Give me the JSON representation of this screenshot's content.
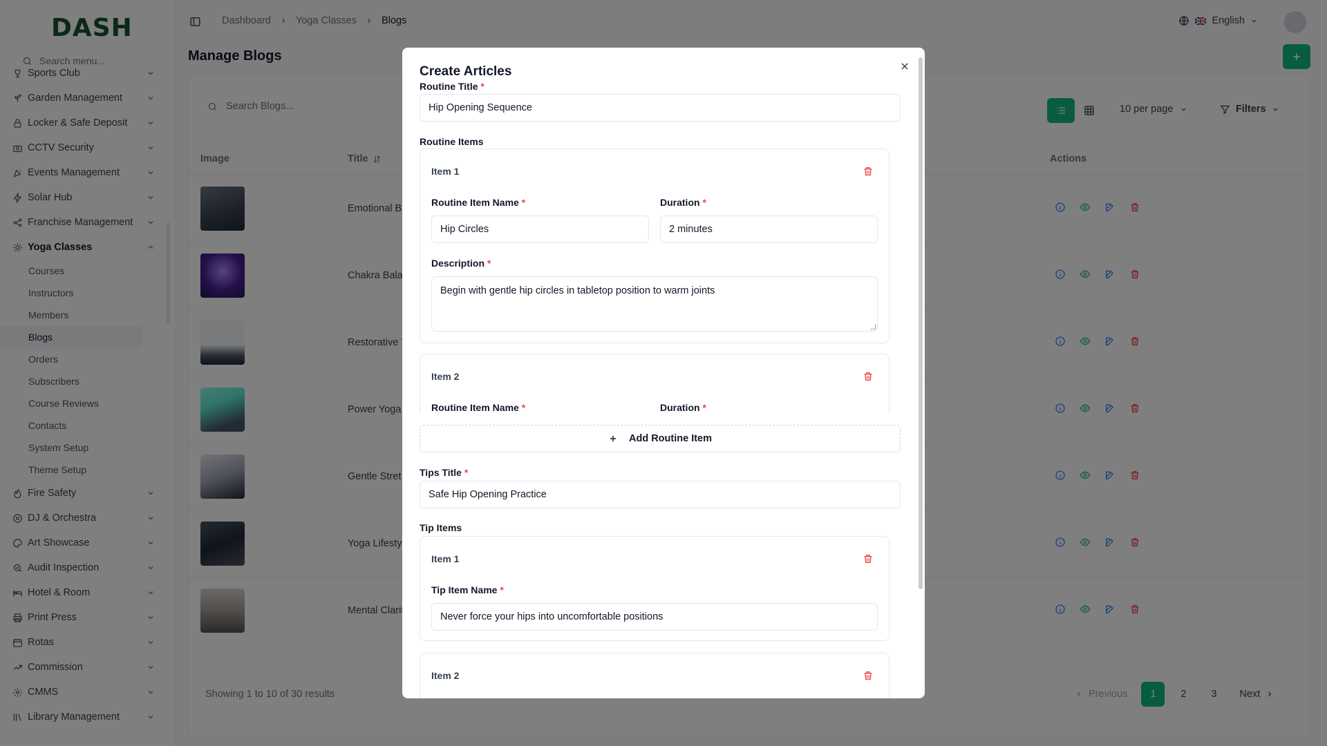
{
  "brand": {
    "logo_text": "DASH",
    "accent": "#10b981"
  },
  "sidebar": {
    "search_placeholder": "Search menu...",
    "items": [
      {
        "label": "Sports Club",
        "icon": "trophy-icon"
      },
      {
        "label": "Garden Management",
        "icon": "plant-icon"
      },
      {
        "label": "Locker & Safe Deposit",
        "icon": "lock-icon"
      },
      {
        "label": "CCTV Security",
        "icon": "camera-icon"
      },
      {
        "label": "Events Management",
        "icon": "party-icon"
      },
      {
        "label": "Solar Hub",
        "icon": "bolt-icon"
      },
      {
        "label": "Franchise Management",
        "icon": "share-icon"
      },
      {
        "label": "Yoga Classes",
        "icon": "sun-icon"
      }
    ],
    "yoga_sub": [
      "Courses",
      "Instructors",
      "Members",
      "Blogs",
      "Orders",
      "Subscribers",
      "Course Reviews",
      "Contacts",
      "System Setup",
      "Theme Setup"
    ],
    "items_after": [
      {
        "label": "Fire Safety",
        "icon": "flame-icon"
      },
      {
        "label": "DJ & Orchestra",
        "icon": "music-icon"
      },
      {
        "label": "Art Showcase",
        "icon": "palette-icon"
      },
      {
        "label": "Audit Inspection",
        "icon": "search-check-icon"
      },
      {
        "label": "Hotel & Room",
        "icon": "bed-icon"
      },
      {
        "label": "Print Press",
        "icon": "printer-icon"
      },
      {
        "label": "Rotas",
        "icon": "calendar-icon"
      },
      {
        "label": "Commission",
        "icon": "trend-icon"
      },
      {
        "label": "CMMS",
        "icon": "gear-icon"
      },
      {
        "label": "Library Management",
        "icon": "library-icon"
      }
    ]
  },
  "topbar": {
    "breadcrumb": [
      "Dashboard",
      "Yoga Classes",
      "Blogs"
    ],
    "language": "English"
  },
  "main": {
    "title": "Manage Blogs",
    "search_placeholder": "Search Blogs...",
    "per_page": "10 per page",
    "filters_label": "Filters",
    "columns": {
      "image": "Image",
      "title": "Title",
      "actions": "Actions"
    },
    "rows": [
      {
        "title": "Emotional Ba"
      },
      {
        "title": "Chakra Balan"
      },
      {
        "title": "Restorative Y"
      },
      {
        "title": "Power Yoga"
      },
      {
        "title": "Gentle Stret"
      },
      {
        "title": "Yoga Lifestyl"
      },
      {
        "title": "Mental Clarit"
      }
    ],
    "showing": "Showing 1 to 10 of 30 results",
    "pager": {
      "prev": "Previous",
      "pages": [
        "1",
        "2",
        "3"
      ],
      "next": "Next"
    }
  },
  "modal": {
    "title": "Create Articles",
    "routine_title_label": "Routine Title",
    "routine_title_value": "Hip Opening Sequence",
    "routine_items_label": "Routine Items",
    "routine_items": [
      {
        "label": "Item 1",
        "name_label": "Routine Item Name",
        "name_value": "Hip Circles",
        "duration_label": "Duration",
        "duration_value": "2 minutes",
        "description_label": "Description",
        "description_value": "Begin with gentle hip circles in tabletop position to warm joints"
      },
      {
        "label": "Item 2",
        "name_label": "Routine Item Name",
        "duration_label": "Duration"
      }
    ],
    "add_routine_item": "Add Routine Item",
    "tips_title_label": "Tips Title",
    "tips_title_value": "Safe Hip Opening Practice",
    "tip_items_label": "Tip Items",
    "tip_items": [
      {
        "label": "Item 1",
        "name_label": "Tip Item Name",
        "name_value": "Never force your hips into uncomfortable positions"
      },
      {
        "label": "Item 2"
      }
    ]
  }
}
